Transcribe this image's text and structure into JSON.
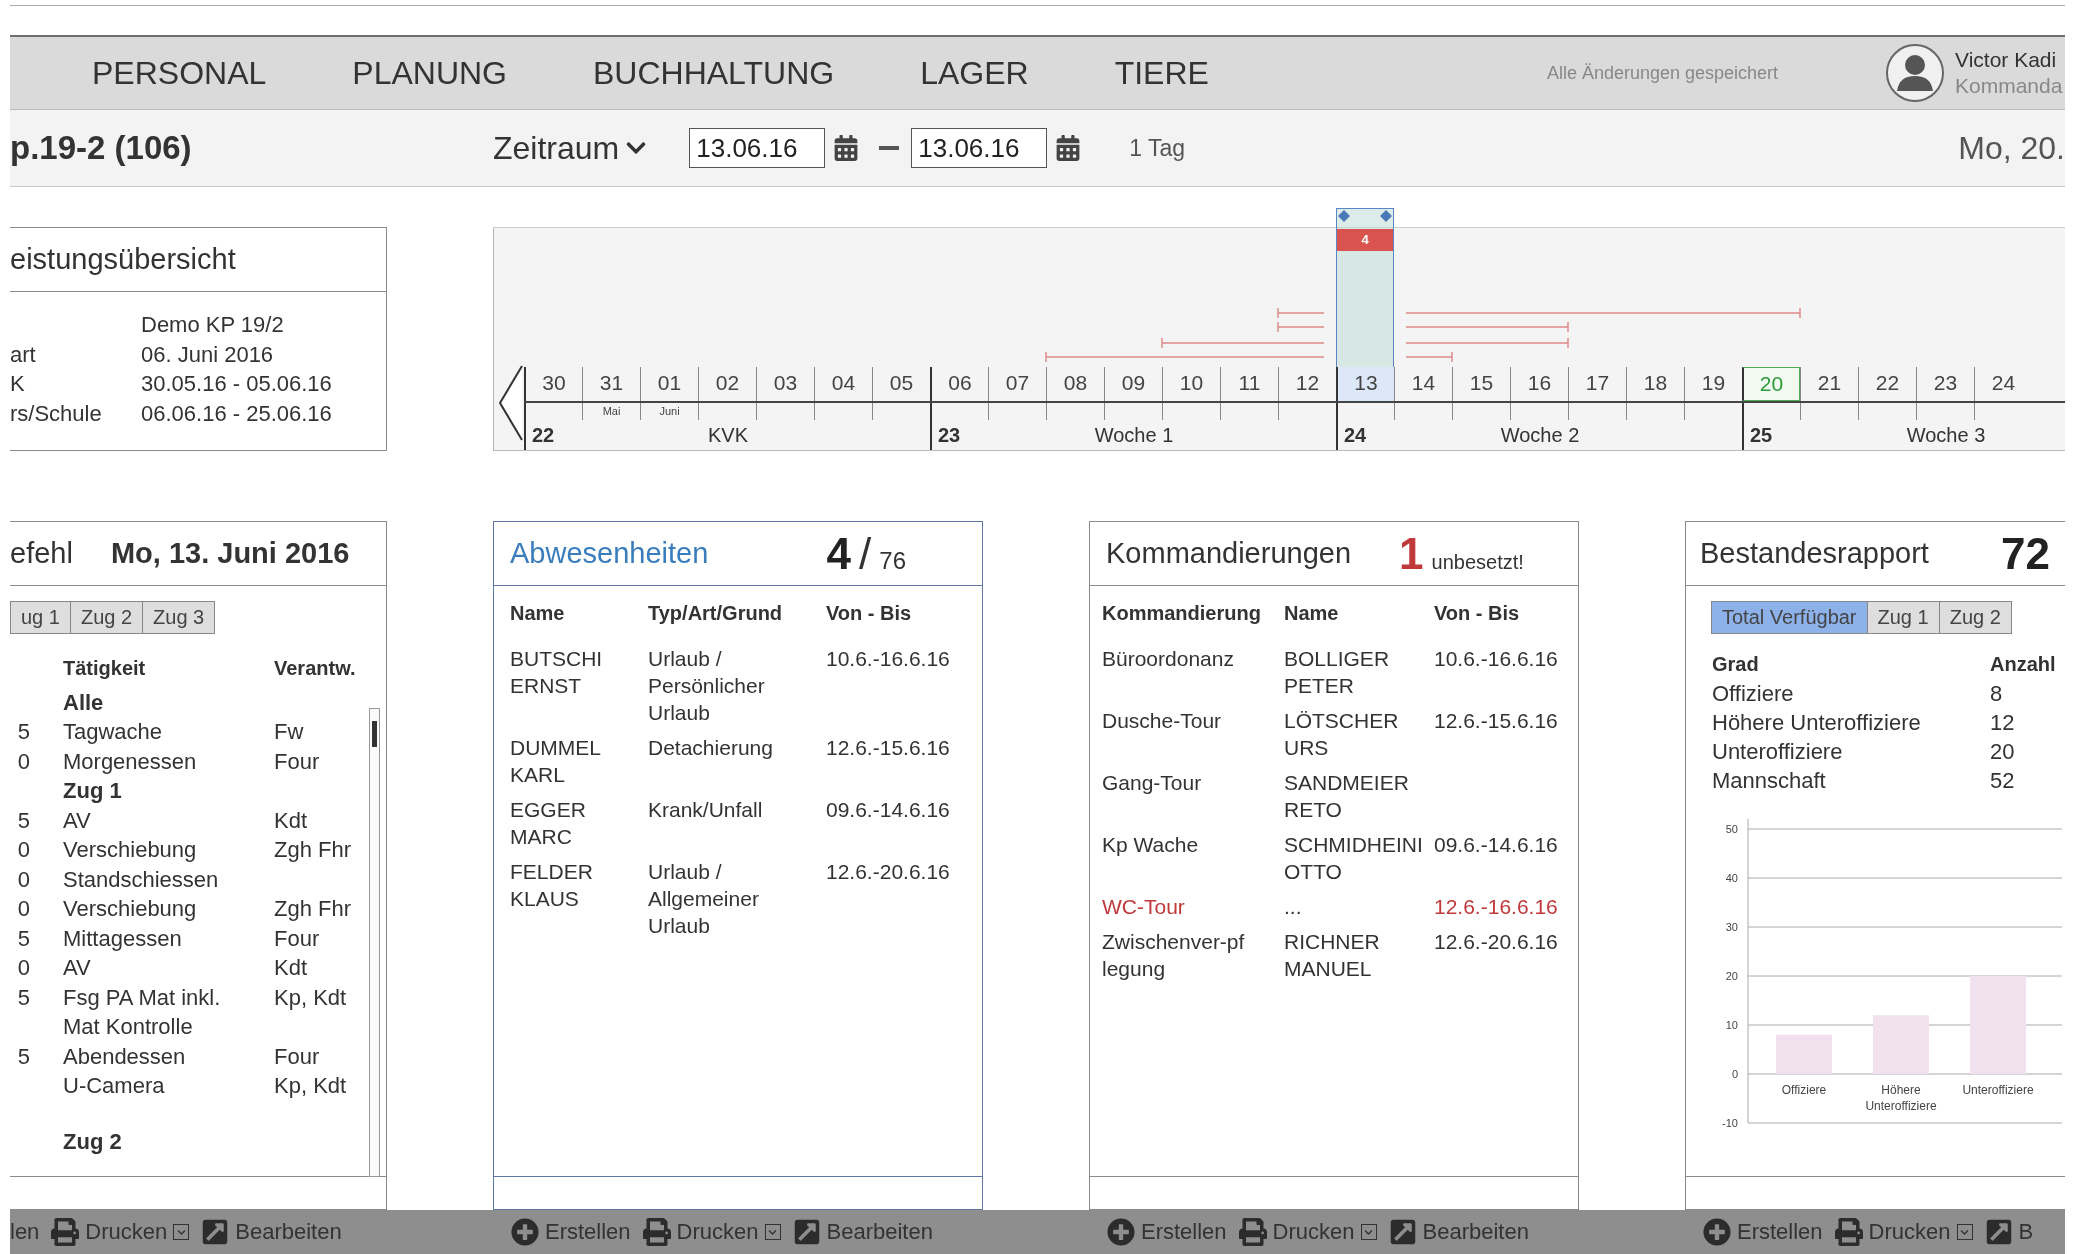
{
  "top_nav": {
    "items": [
      "PERSONAL",
      "PLANUNG",
      "BUCHHALTUNG",
      "LAGER",
      "TIERE"
    ],
    "save_status": "Alle Änderungen gespeichert",
    "user": {
      "name": "Victor Kadi",
      "role": "Kommanda"
    }
  },
  "toolbar": {
    "unit": "p.19-2 (106)",
    "period": "Zeitraum",
    "date_from": "13.06.16",
    "date_to": "13.06.16",
    "duration": "1 Tag",
    "current_date": "Mo, 20."
  },
  "overview": {
    "title": "eistungsübersicht",
    "rows": [
      {
        "value": "Demo KP 19/2"
      },
      {
        "label": "art",
        "value": "06. Juni 2016"
      },
      {
        "label": "K",
        "value": "30.05.16 - 05.06.16"
      },
      {
        "label": "rs/Schule",
        "value": "06.06.16 - 25.06.16"
      }
    ]
  },
  "timeline": {
    "selection_count": "4",
    "days": [
      {
        "label": "30",
        "selected": false,
        "today": false
      },
      {
        "label": "31",
        "month": "Mai",
        "selected": false,
        "today": false
      },
      {
        "label": "01",
        "month": "Juni",
        "selected": false,
        "today": false
      },
      {
        "label": "02",
        "selected": false,
        "today": false
      },
      {
        "label": "03",
        "selected": false,
        "today": false
      },
      {
        "label": "04",
        "selected": false,
        "today": false
      },
      {
        "label": "05",
        "selected": false,
        "today": false
      },
      {
        "label": "06",
        "selected": false,
        "today": false
      },
      {
        "label": "07",
        "selected": false,
        "today": false
      },
      {
        "label": "08",
        "selected": false,
        "today": false
      },
      {
        "label": "09",
        "selected": false,
        "today": false
      },
      {
        "label": "10",
        "selected": false,
        "today": false
      },
      {
        "label": "11",
        "selected": false,
        "today": false
      },
      {
        "label": "12",
        "selected": false,
        "today": false
      },
      {
        "label": "13",
        "selected": true,
        "today": false
      },
      {
        "label": "14",
        "selected": false,
        "today": false
      },
      {
        "label": "15",
        "selected": false,
        "today": false
      },
      {
        "label": "16",
        "selected": false,
        "today": false
      },
      {
        "label": "17",
        "selected": false,
        "today": false
      },
      {
        "label": "18",
        "selected": false,
        "today": false
      },
      {
        "label": "19",
        "selected": false,
        "today": false
      },
      {
        "label": "20",
        "selected": false,
        "today": true
      },
      {
        "label": "21",
        "selected": false,
        "today": false
      },
      {
        "label": "22",
        "selected": false,
        "today": false
      },
      {
        "label": "23",
        "selected": false,
        "today": false
      },
      {
        "label": "24",
        "selected": false,
        "today": false
      }
    ],
    "weeks": [
      {
        "number": "22",
        "label": "KVK"
      },
      {
        "number": "23",
        "label": "Woche 1"
      },
      {
        "number": "24",
        "label": "Woche 2"
      },
      {
        "number": "25",
        "label": "Woche 3"
      }
    ]
  },
  "orders": {
    "title": "efehl",
    "date": "Mo, 13. Juni 2016",
    "tabs": [
      {
        "label": "ug 1",
        "selected": false
      },
      {
        "label": "Zug 2",
        "selected": false
      },
      {
        "label": "Zug 3",
        "selected": false
      }
    ],
    "columns": [
      "Tätigkeit",
      "Verantw."
    ],
    "rows": [
      {
        "kind": "group",
        "activity": "Alle"
      },
      {
        "kind": "entry",
        "time": "5",
        "activity": "Tagwache",
        "responsible": "Fw"
      },
      {
        "kind": "entry",
        "time": "0",
        "activity": "Morgenessen",
        "responsible": "Four"
      },
      {
        "kind": "group",
        "activity": "Zug 1"
      },
      {
        "kind": "entry",
        "time": "5",
        "activity": "AV",
        "responsible": "Kdt"
      },
      {
        "kind": "entry",
        "time": "0",
        "activity": "Verschiebung",
        "responsible": "Zgh Fhr"
      },
      {
        "kind": "entry",
        "time": "0",
        "activity": "Standschiessen"
      },
      {
        "kind": "entry",
        "time": "0",
        "activity": "Verschiebung",
        "responsible": "Zgh Fhr"
      },
      {
        "kind": "entry",
        "time": "5",
        "activity": "Mittagessen",
        "responsible": "Four"
      },
      {
        "kind": "entry",
        "time": "0",
        "activity": "AV",
        "responsible": "Kdt"
      },
      {
        "kind": "entry",
        "time": "5",
        "activity": "Fsg PA Mat inkl. Mat Kontrolle",
        "responsible": "Kp, Kdt"
      },
      {
        "kind": "entry",
        "time": "5",
        "activity": "Abendessen",
        "responsible": "Four"
      },
      {
        "kind": "entry",
        "activity": "U-Camera",
        "responsible": "Kp, Kdt"
      },
      {
        "kind": "group",
        "activity": "Zug 2"
      }
    ],
    "footer": [
      {
        "kind": "plain",
        "label": "len"
      },
      {
        "kind": "print",
        "label": "Drucken"
      },
      {
        "kind": "edit",
        "label": "Bearbeiten"
      }
    ]
  },
  "absences": {
    "title": "Abwesenheiten",
    "count": "4",
    "separator": "/",
    "total": "76",
    "columns": [
      "Name",
      "Typ/Art/Grund",
      "Von - Bis"
    ],
    "rows": [
      {
        "name": "BUTSCHI ERNST",
        "reason": "Urlaub / Persönlicher Urlaub",
        "period": "10.6.-16.6.16"
      },
      {
        "name": "DUMMEL KARL",
        "reason": "Detachierung",
        "period": "12.6.-15.6.16"
      },
      {
        "name": "EGGER MARC",
        "reason": "Krank/Unfall",
        "period": "09.6.-14.6.16"
      },
      {
        "name": "FELDER KLAUS",
        "reason": "Urlaub / Allgemeiner Urlaub",
        "period": "12.6.-20.6.16"
      }
    ],
    "footer": [
      {
        "kind": "create",
        "label": "Erstellen"
      },
      {
        "kind": "print",
        "label": "Drucken"
      },
      {
        "kind": "edit",
        "label": "Bearbeiten"
      }
    ]
  },
  "assignments": {
    "title": "Kommandierungen",
    "open_count": "1",
    "open_label": "unbesetzt!",
    "columns": [
      "Kommandierung",
      "Name",
      "Von - Bis"
    ],
    "rows": [
      {
        "assignment": "Büroordonanz",
        "name": "BOLLIGER PETER",
        "period": "10.6.-16.6.16",
        "unfilled": false
      },
      {
        "assignment": "Dusche-Tour",
        "name": "LÖTSCHER URS",
        "period": "12.6.-15.6.16",
        "unfilled": false
      },
      {
        "assignment": "Gang-Tour",
        "name": "SANDMEIER RETO",
        "unfilled": false
      },
      {
        "assignment": "Kp Wache",
        "name": "SCHMIDHEINI OTTO",
        "period": "09.6.-14.6.16",
        "unfilled": false
      },
      {
        "assignment": "WC-Tour",
        "name": "...",
        "period": "12.6.-16.6.16",
        "unfilled": true
      },
      {
        "assignment": "Zwischenver-pf legung",
        "name": "RICHNER MANUEL",
        "period": "12.6.-20.6.16",
        "unfilled": false
      }
    ],
    "footer": [
      {
        "kind": "create",
        "label": "Erstellen"
      },
      {
        "kind": "print",
        "label": "Drucken"
      },
      {
        "kind": "edit",
        "label": "Bearbeiten"
      }
    ]
  },
  "strength": {
    "title": "Bestandesrapport",
    "total": "72",
    "tabs": [
      {
        "label": "Total Verfügbar",
        "selected": true
      },
      {
        "label": "Zug 1",
        "selected": false
      },
      {
        "label": "Zug 2",
        "selected": false
      }
    ],
    "columns": [
      "Grad",
      "Anzahl"
    ],
    "rows": [
      {
        "grade": "Offiziere",
        "count": "8"
      },
      {
        "grade": "Höhere Unteroffiziere",
        "count": "12"
      },
      {
        "grade": "Unteroffiziere",
        "count": "20"
      },
      {
        "grade": "Mannschaft",
        "count": "52"
      }
    ],
    "chart_data": {
      "type": "bar",
      "categories": [
        "Offiziere",
        "Höhere Unteroffiziere",
        "Unteroffiziere"
      ],
      "values": [
        8,
        12,
        20
      ],
      "grid": true,
      "ylim": [
        -10,
        50
      ],
      "yticks": [
        -10,
        0,
        10,
        20,
        30,
        40,
        50
      ]
    },
    "footer": [
      {
        "kind": "create",
        "label": "Erstellen"
      },
      {
        "kind": "print",
        "label": "Drucken"
      },
      {
        "kind": "edit",
        "label": "B"
      }
    ]
  }
}
